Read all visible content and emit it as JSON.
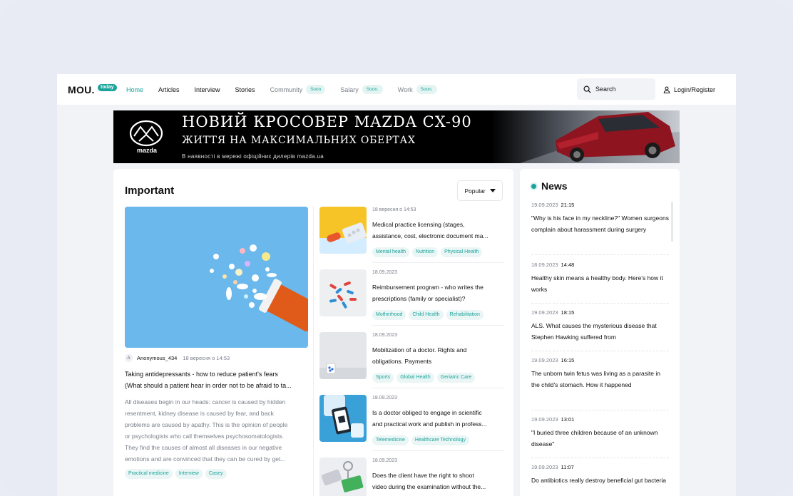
{
  "header": {
    "logo": "MOU.",
    "logo_badge": "today",
    "nav": [
      {
        "label": "Home",
        "state": "active"
      },
      {
        "label": "Articles",
        "state": "normal"
      },
      {
        "label": "Interview",
        "state": "normal"
      },
      {
        "label": "Stories",
        "state": "normal"
      },
      {
        "label": "Community",
        "state": "muted",
        "badge": "Soon"
      },
      {
        "label": "Salary",
        "state": "muted",
        "badge": "Soon."
      },
      {
        "label": "Work",
        "state": "muted",
        "badge": "Soon."
      }
    ],
    "search_label": "Search",
    "login_label": "Login/Register"
  },
  "banner": {
    "headline": "НОВИЙ КРОСОВЕР MAZDA CX-90",
    "subheadline": "ЖИТТЯ НА МАКСИМАЛЬНИХ ОБЕРТАХ",
    "footnote": "В наявності в мережі офіційних дилерів mazda.ua",
    "brand": "mazda"
  },
  "important": {
    "title": "Important",
    "sort_label": "Popular",
    "hero": {
      "author_initial": "A",
      "author": "Anonymous_434",
      "date": "18 вересня о 14:53",
      "title_lines": [
        "Taking antidepressants - how to reduce patient's fears",
        "(What should a patient hear in order not to be afraid to ta..."
      ],
      "text_lines": [
        "All diseases begin in our heads: cancer is caused by hidden",
        "resentment, kidney disease is caused by fear, and back",
        "problems are caused by apathy. This is the opinion of people",
        "or psychologists who call themselves psychosomatologists.",
        "They find the causes of almost all diseases in our negative",
        "emotions and are convinced that they can be cured by get..."
      ],
      "tags": [
        "Practical medicine",
        "Interview",
        "Casey"
      ]
    },
    "list": [
      {
        "date": "18 вересня о 14:53",
        "title_lines": [
          "Medical practice licensing (stages,",
          "assistance, cost, electronic document ma..."
        ],
        "tags": [
          "Mental health",
          "Nutrition",
          "Physical Health"
        ]
      },
      {
        "date": "18.09.2023",
        "title_lines": [
          "Reimbursement program - who writes the",
          "prescriptions (family or specialist)?"
        ],
        "tags": [
          "Motherhood",
          "Child Health",
          "Rehabilitation"
        ]
      },
      {
        "date": "18.09.2023",
        "title_lines": [
          "Mobilization of a doctor. Rights and",
          "obligations. Payments"
        ],
        "tags": [
          "Sports",
          "Global Health",
          "Geriatric Care"
        ]
      },
      {
        "date": "18.09.2023",
        "title_lines": [
          "Is a doctor obliged to engage in scientific",
          "and practical work and publish in profess..."
        ],
        "tags": [
          "Telemedicine",
          "Healthcare Technology"
        ]
      },
      {
        "date": "18.09.2023",
        "title_lines": [
          "Does the client have the right to shoot",
          "video during the examination without the..."
        ],
        "tags": []
      }
    ]
  },
  "news": {
    "title": "News",
    "items": [
      {
        "date": "19.09.2023",
        "time": "21:15",
        "title": "\"Why is his face in my neckline?\" Women surgeons complain about harassment during surgery"
      },
      {
        "date": "18.09.2023",
        "time": "14:48",
        "title": "Healthy skin means a healthy body. Here's how it works"
      },
      {
        "date": "19.09.2023",
        "time": "18:15",
        "title": "ALS. What causes the mysterious disease that Stephen Hawking suffered from"
      },
      {
        "date": "19.09.2023",
        "time": "16:15",
        "title": "The unborn twin fetus was living as a parasite in the child's stomach. How it happened"
      },
      {
        "date": "19.09.2023",
        "time": "13:01",
        "title": "\"I buried three children because of an unknown disease\""
      },
      {
        "date": "19.09.2023",
        "time": "11:07",
        "title": "Do antibiotics really destroy beneficial gut bacteria"
      }
    ]
  },
  "colors": {
    "accent": "#1aa39b",
    "page_bg": "#e9ecf5",
    "card_bg": "#ffffff"
  }
}
